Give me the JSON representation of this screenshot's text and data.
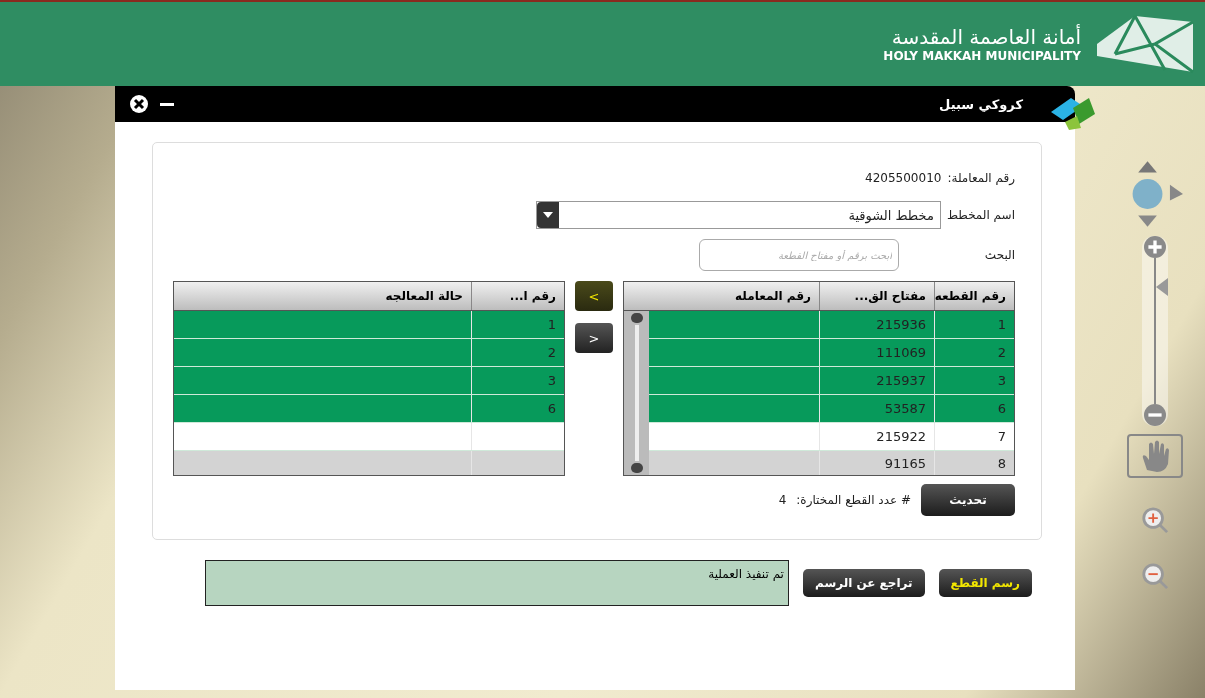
{
  "header": {
    "title_ar": "أمانة العاصمة المقدسة",
    "title_en": "HOLY MAKKAH MUNICIPALITY"
  },
  "dialog": {
    "title": "كروكي سبيل"
  },
  "transaction": {
    "label": "رقم المعاملة:",
    "value": "4205500010"
  },
  "plan": {
    "label": "اسم المخطط",
    "value": "مخطط الشوقية"
  },
  "search": {
    "label": "البحث",
    "placeholder": "ابحث برقم أو مفتاح القطعة"
  },
  "source_table": {
    "columns": [
      "رقم القطعه",
      "مفتاح الق...",
      "رقم المعامله"
    ],
    "rows": [
      {
        "cells": [
          "1",
          "215936",
          ""
        ],
        "selected": true
      },
      {
        "cells": [
          "2",
          "111069",
          ""
        ],
        "selected": true
      },
      {
        "cells": [
          "3",
          "215937",
          ""
        ],
        "selected": true
      },
      {
        "cells": [
          "6",
          "53587",
          ""
        ],
        "selected": true
      },
      {
        "cells": [
          "7",
          "215922",
          ""
        ],
        "selected": false
      },
      {
        "cells": [
          "8",
          "91165",
          ""
        ],
        "selected": false
      }
    ]
  },
  "move_buttons": [
    {
      "label": "<",
      "active": true
    },
    {
      "label": ">",
      "active": false
    }
  ],
  "target_table": {
    "columns": [
      "رقم ا...",
      "حالة المعالجه"
    ],
    "rows": [
      {
        "cells": [
          "1",
          ""
        ],
        "selected": true
      },
      {
        "cells": [
          "2",
          ""
        ],
        "selected": true
      },
      {
        "cells": [
          "3",
          ""
        ],
        "selected": true
      },
      {
        "cells": [
          "6",
          ""
        ],
        "selected": true
      }
    ]
  },
  "refresh_button": "تحديث",
  "count": {
    "label": "# عدد القطع المختارة:",
    "value": "4"
  },
  "actions": [
    {
      "label": "رسم القطع",
      "active": true
    },
    {
      "label": "تراجع عن الرسم",
      "active": false
    }
  ],
  "status": "تم تنفيذ العملية",
  "zoom_slider": {
    "level": 0.8
  }
}
